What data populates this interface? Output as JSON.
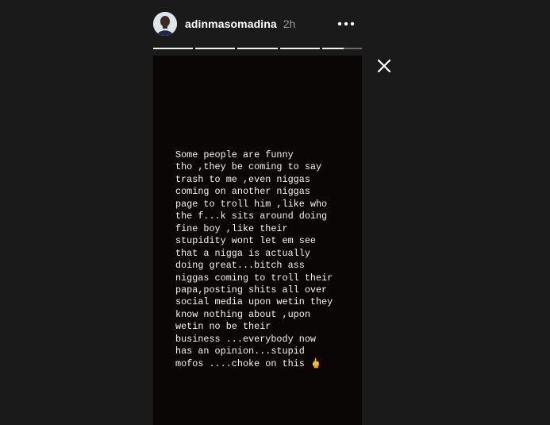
{
  "header": {
    "username": "adinmasomadina",
    "timestamp": "2h",
    "avatar_icon": "user-avatar",
    "more_icon": "more-horizontal-icon"
  },
  "progress": {
    "segments": 5,
    "completed_segments": 4,
    "current_segment_fraction": 0.55
  },
  "story": {
    "text_lines": [
      "Some people are funny",
      "tho ,they be coming to say",
      "trash to me ,even niggas",
      "coming on another niggas",
      "page to troll him ,like who",
      "the f...k sits around doing",
      "fine boy ,like their",
      "stupidity wont let em see",
      "that a nigga is actually",
      "doing great...bitch ass",
      "niggas coming to troll their",
      "papa,posting shits all over",
      "social media upon wetin they",
      "know nothing about ,upon",
      "wetin no be their",
      "business ...everybody now",
      "has an opinion...stupid",
      "mofos ....choke on this 🖕"
    ],
    "background_color": "#0a0606"
  },
  "controls": {
    "close_icon": "close-icon"
  }
}
